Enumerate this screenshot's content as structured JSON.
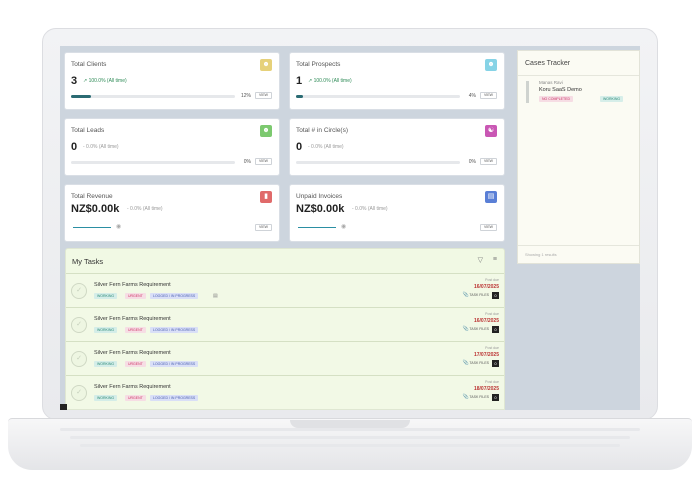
{
  "stats": {
    "clients": {
      "title": "Total Clients",
      "value": "3",
      "change": "↗ 100.0% (All time)",
      "pct": "12%",
      "pct_value": 12,
      "view": "VIEW",
      "icon": "person-icon",
      "icon_color": "#e6d17a"
    },
    "prospects": {
      "title": "Total Prospects",
      "value": "1",
      "change": "↗ 100.0% (All time)",
      "pct": "4%",
      "pct_value": 4,
      "view": "VIEW",
      "icon": "person-icon",
      "icon_color": "#86d3e6"
    },
    "leads": {
      "title": "Total Leads",
      "value": "0",
      "change": "- 0.0% (All time)",
      "pct": "0%",
      "pct_value": 0,
      "view": "VIEW",
      "icon": "person-icon",
      "icon_color": "#7cc96f"
    },
    "circle": {
      "title": "Total # in Circle(s)",
      "value": "0",
      "change": "- 0.0% (All time)",
      "pct": "0%",
      "pct_value": 0,
      "view": "VIEW",
      "icon": "group-icon",
      "icon_color": "#c957b4"
    },
    "revenue": {
      "title": "Total Revenue",
      "value": "NZ$0.00k",
      "change": "- 0.0% (All time)",
      "view": "VIEW",
      "icon": "chart-icon",
      "icon_color": "#e06a6a"
    },
    "unpaid": {
      "title": "Unpaid Invoices",
      "value": "NZ$0.00k",
      "change": "- 0.0% (All time)",
      "view": "VIEW",
      "icon": "invoice-icon",
      "icon_color": "#5a7fd6"
    }
  },
  "cases": {
    "title": "Cases Tracker",
    "item": {
      "sub": "Manas Ravi",
      "name": "Koru SaaS Demo",
      "tag1": "NO COMPLETED",
      "tag2": "WORKING"
    },
    "footer": "Showing 1 results"
  },
  "tasks": {
    "title": "My Tasks",
    "items": [
      {
        "name": "Silver Fern Farms Requirement",
        "tags": [
          "WORKING",
          "URGENT",
          "LOGGED / IN PROGRESS"
        ],
        "due_label": "Post due",
        "due": "16/07/2025",
        "files_label": "TASK FILES",
        "files": "0"
      },
      {
        "name": "Silver Fern Farms Requirement",
        "tags": [
          "WORKING",
          "URGENT",
          "LOGGED / IN PROGRESS"
        ],
        "due_label": "Post due",
        "due": "16/07/2025",
        "files_label": "TASK FILES",
        "files": "0"
      },
      {
        "name": "Silver Fern Farms Requirement",
        "tags": [
          "WORKING",
          "URGENT",
          "LOGGED / IN PROGRESS"
        ],
        "due_label": "Post due",
        "due": "17/07/2025",
        "files_label": "TASK FILES",
        "files": "0"
      },
      {
        "name": "Silver Fern Farms Requirement",
        "tags": [
          "WORKING",
          "URGENT",
          "LOGGED / IN PROGRESS"
        ],
        "due_label": "Post due",
        "due": "18/07/2025",
        "files_label": "TASK FILES",
        "files": "0"
      }
    ]
  }
}
